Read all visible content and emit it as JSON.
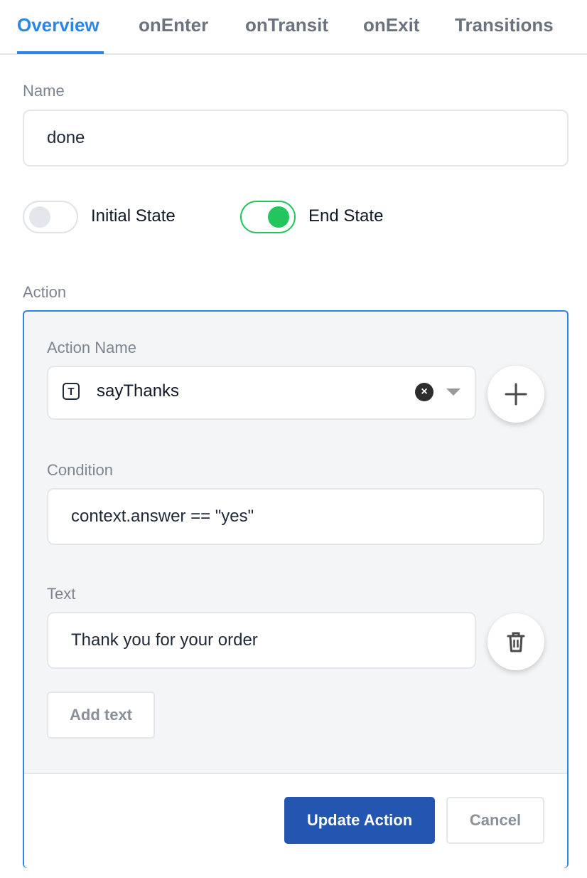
{
  "tabs": [
    {
      "label": "Overview",
      "active": true
    },
    {
      "label": "onEnter",
      "active": false
    },
    {
      "label": "onTransit",
      "active": false
    },
    {
      "label": "onExit",
      "active": false
    },
    {
      "label": "Transitions",
      "active": false
    }
  ],
  "name_field": {
    "label": "Name",
    "value": "done"
  },
  "toggles": {
    "initial_state": {
      "label": "Initial State",
      "on": false
    },
    "end_state": {
      "label": "End State",
      "on": true
    }
  },
  "action": {
    "section_label": "Action",
    "action_name": {
      "label": "Action Name",
      "value": "sayThanks",
      "type_icon": "T"
    },
    "condition": {
      "label": "Condition",
      "value": "context.answer == \"yes\""
    },
    "text": {
      "label": "Text",
      "value": "Thank you for your order"
    },
    "add_text_label": "Add text",
    "update_label": "Update Action",
    "cancel_label": "Cancel"
  },
  "colors": {
    "accent": "#2b86e6",
    "toggle_on": "#22c55e",
    "primary_button": "#2356b0"
  },
  "icons": {
    "clear": "close-circle-icon",
    "dropdown": "chevron-down-icon",
    "add": "plus-icon",
    "delete": "trash-icon"
  }
}
